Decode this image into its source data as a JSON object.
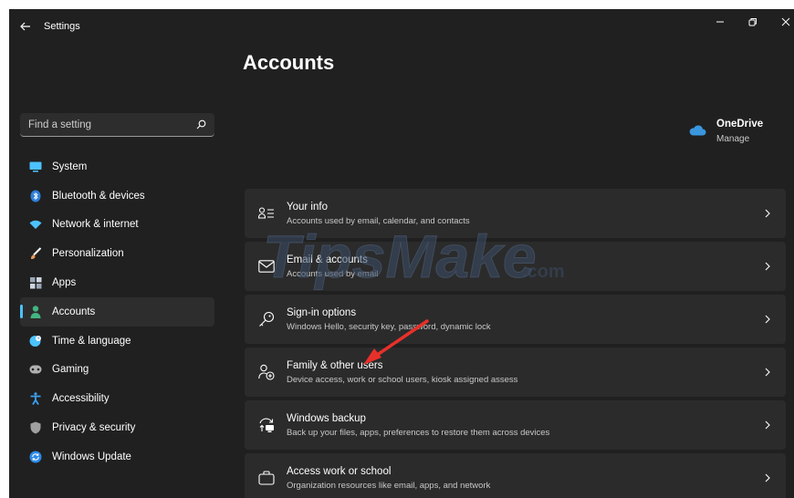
{
  "window": {
    "title": "Settings"
  },
  "page": {
    "title": "Accounts"
  },
  "search": {
    "placeholder": "Find a setting",
    "value": ""
  },
  "onedrive": {
    "name": "OneDrive",
    "action": "Manage",
    "icon": "cloud-icon"
  },
  "sidebar": {
    "items": [
      {
        "label": "System",
        "icon": "monitor-icon",
        "color": "#4cc2ff"
      },
      {
        "label": "Bluetooth & devices",
        "icon": "bluetooth-icon",
        "color": "#2d7fd8"
      },
      {
        "label": "Network & internet",
        "icon": "wifi-icon",
        "color": "#4cc2ff"
      },
      {
        "label": "Personalization",
        "icon": "brush-icon",
        "color": "#e89a5a"
      },
      {
        "label": "Apps",
        "icon": "apps-icon",
        "color": "#9aa6b8"
      },
      {
        "label": "Accounts",
        "icon": "person-icon",
        "color": "#43b581",
        "active": true
      },
      {
        "label": "Time & language",
        "icon": "globe-clock-icon",
        "color": "#4cc2ff"
      },
      {
        "label": "Gaming",
        "icon": "gamepad-icon",
        "color": "#b0b0b0"
      },
      {
        "label": "Accessibility",
        "icon": "accessibility-icon",
        "color": "#3aa0f0"
      },
      {
        "label": "Privacy & security",
        "icon": "shield-icon",
        "color": "#a0a0a0"
      },
      {
        "label": "Windows Update",
        "icon": "update-icon",
        "color": "#2d8ae8"
      }
    ]
  },
  "cards": [
    {
      "title": "Your info",
      "subtitle": "Accounts used by email, calendar, and contacts",
      "icon": "user-info-icon"
    },
    {
      "title": "Email & accounts",
      "subtitle": "Accounts used by email",
      "icon": "mail-icon"
    },
    {
      "title": "Sign-in options",
      "subtitle": "Windows Hello, security key, password, dynamic lock",
      "icon": "key-icon"
    },
    {
      "title": "Family & other users",
      "subtitle": "Device access, work or school users, kiosk assigned assess",
      "icon": "family-icon"
    },
    {
      "title": "Windows backup",
      "subtitle": "Back up your files, apps, preferences to restore them across devices",
      "icon": "backup-icon"
    },
    {
      "title": "Access work or school",
      "subtitle": "Organization resources like email, apps, and network",
      "icon": "briefcase-icon"
    }
  ],
  "watermark": {
    "text": "TipsMake",
    "suffix": ".com"
  },
  "colors": {
    "accent": "#4cc2ff",
    "background": "#202020",
    "card": "#2b2b2b",
    "arrow": "#e8302a"
  }
}
